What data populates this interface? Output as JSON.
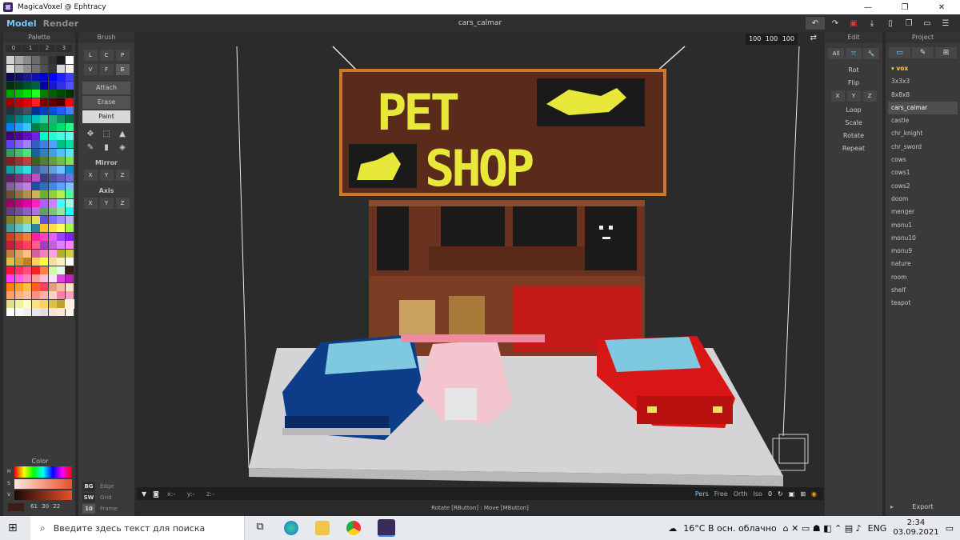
{
  "window": {
    "title": "MagicaVoxel @ Ephtracy",
    "minimize": "—",
    "maximize": "❐",
    "close": "✕"
  },
  "header": {
    "modes": [
      "Model",
      "Render"
    ],
    "filename": "cars_calmar",
    "tools": [
      "undo-icon",
      "redo-icon",
      "save-icon",
      "export-icon",
      "new-icon",
      "copy-icon",
      "open-icon",
      "menu-icon"
    ]
  },
  "palette": {
    "title": "Palette",
    "tabs": [
      "0",
      "1",
      "2",
      "3"
    ],
    "color_section": "Color",
    "hsv_labels": [
      "H",
      "S",
      "V"
    ],
    "rgb": "61 30 22",
    "colors": [
      "#d0d0d0",
      "#a8a8a8",
      "#8a8a8a",
      "#6a6a6a",
      "#4a4a4a",
      "#303030",
      "#1a1a1a",
      "#ffffff",
      "#e0e0e0",
      "#b0b0b0",
      "#909090",
      "#707070",
      "#505050",
      "#383838",
      "#d8d8d8",
      "#f0f0f0",
      "#0a0a50",
      "#10106a",
      "#181888",
      "#1010b0",
      "#0000d0",
      "#0000ff",
      "#2020ff",
      "#4040ff",
      "#003010",
      "#004020",
      "#005030",
      "#006040",
      "#0000a0",
      "#1818c8",
      "#3030e0",
      "#5050ff",
      "#00a000",
      "#00c000",
      "#00e000",
      "#20ff20",
      "#008000",
      "#006000",
      "#004800",
      "#003000",
      "#a00000",
      "#c00000",
      "#e00000",
      "#ff2020",
      "#800000",
      "#600000",
      "#480000",
      "#ff0000",
      "#203040",
      "#304050",
      "#405060",
      "#0030a0",
      "#0040c0",
      "#0050e0",
      "#2060ff",
      "#4080ff",
      "#006060",
      "#008080",
      "#00a0a0",
      "#00c0c0",
      "#30d0a0",
      "#20b080",
      "#109060",
      "#007040",
      "#0080ff",
      "#20a0ff",
      "#40c0ff",
      "#008040",
      "#00a050",
      "#00c060",
      "#00e070",
      "#20ff90",
      "#400080",
      "#5000a0",
      "#6010c0",
      "#7020e0",
      "#00ffc0",
      "#20ffd0",
      "#40ffe0",
      "#60fff0",
      "#6040ff",
      "#8060ff",
      "#a080ff",
      "#3060c0",
      "#4080e0",
      "#50a0ff",
      "#00c080",
      "#00e0a0",
      "#30a060",
      "#40c070",
      "#50e080",
      "#2060a0",
      "#3080c0",
      "#40a0e0",
      "#50c0ff",
      "#60e0ff",
      "#802020",
      "#a03030",
      "#c04040",
      "#406020",
      "#508030",
      "#60a040",
      "#70c050",
      "#80e060",
      "#10a0a0",
      "#20c0c0",
      "#30e0e0",
      "#4060a0",
      "#5080c0",
      "#60a0e0",
      "#70c0ff",
      "#1090d0",
      "#602060",
      "#803080",
      "#a040a0",
      "#c050c0",
      "#404080",
      "#5050a0",
      "#6060c0",
      "#7070e0",
      "#8060a0",
      "#a070c0",
      "#c080e0",
      "#2050a0",
      "#306fc0",
      "#4088e0",
      "#60a0ff",
      "#80c0ff",
      "#705030",
      "#907040",
      "#b09050",
      "#d0b060",
      "#70b030",
      "#90d040",
      "#b0f050",
      "#40ffa0",
      "#a00060",
      "#c00080",
      "#e000a0",
      "#ff20c0",
      "#b060ff",
      "#d080ff",
      "#40ffff",
      "#a0ffe0",
      "#604080",
      "#7050a0",
      "#9060c0",
      "#b070e0",
      "#60a060",
      "#80c080",
      "#a0e0a0",
      "#20ffff",
      "#808020",
      "#a0a030",
      "#c0c040",
      "#e0e050",
      "#6050e0",
      "#8070ff",
      "#a090ff",
      "#c0b0ff",
      "#40a0a0",
      "#60c0c0",
      "#80e0e0",
      "#3080a0",
      "#ffc030",
      "#ffe040",
      "#ffff60",
      "#a0ff40",
      "#d04020",
      "#e06030",
      "#f08040",
      "#ff20a0",
      "#ff40c0",
      "#e060ff",
      "#a040ff",
      "#8020ff",
      "#c02040",
      "#e03050",
      "#ff4060",
      "#ff6080",
      "#a040c0",
      "#c060e0",
      "#e080ff",
      "#ff80ff",
      "#c08040",
      "#e0a060",
      "#ffc080",
      "#d060a0",
      "#f080c0",
      "#ffa0e0",
      "#b0b030",
      "#d0d040",
      "#e0c040",
      "#d0a030",
      "#c08020",
      "#ffd060",
      "#ffff40",
      "#f0e0a0",
      "#fff0c0",
      "#ffffff",
      "#ff1040",
      "#ff3060",
      "#ff5080",
      "#ff2020",
      "#ff8040",
      "#d0ffa0",
      "#e0ffe0",
      "#3d1e16",
      "#ff40ff",
      "#ff60e0",
      "#ff80c0",
      "#ffa0a0",
      "#ffc0e0",
      "#ffe0ff",
      "#e040e0",
      "#c020c0",
      "#ff8000",
      "#ffa020",
      "#ffc040",
      "#ff6020",
      "#ff4060",
      "#e0a080",
      "#f0c0a0",
      "#ffe0c0",
      "#ffa060",
      "#ffb080",
      "#ffc0a0",
      "#ff9080",
      "#ffb0a0",
      "#ffd0c0",
      "#ff80a0",
      "#ffa0c0",
      "#e0e080",
      "#f0f0a0",
      "#ffffc0",
      "#ffe080",
      "#ffd060",
      "#e0c040",
      "#c0a030",
      "#fff0e0",
      "#ffffff",
      "#f8f8f8",
      "#f0f0f0",
      "#e8e8e8",
      "#e0e0e0",
      "#f4e4d4",
      "#ffe8d0",
      "#fff4e8"
    ]
  },
  "brush": {
    "title": "Brush",
    "shape_row1": [
      "L",
      "C",
      "P"
    ],
    "shape_row2": [
      "V",
      "F",
      "B"
    ],
    "modes": [
      "Attach",
      "Erase",
      "Paint"
    ],
    "active_mode": "Paint",
    "tool_icons": [
      "move-icon",
      "select-icon",
      "pick-shape-icon",
      "eyedropper-icon",
      "delete-icon",
      "fill-icon"
    ],
    "mirror_label": "Mirror",
    "mirror": [
      "X",
      "Y",
      "Z"
    ],
    "axis_label": "Axis",
    "axis": [
      "X",
      "Y",
      "Z"
    ],
    "bg": {
      "bg": "BG",
      "edge": "Edge",
      "sw": "SW",
      "grid": "Grid",
      "frame_num": "10",
      "frame": "Frame"
    }
  },
  "viewport": {
    "size": "100 100 100",
    "coords": "x:-   y:-   z:-",
    "views": [
      "Pers",
      "Free",
      "Orth",
      "Iso"
    ],
    "active_view": "Pers",
    "zoom": "0",
    "status": "Rotate [RButton] : Move [MButton]",
    "scene_text": {
      "pet": "PET",
      "shop": "SHOP"
    }
  },
  "edit": {
    "title": "Edit",
    "tabs": [
      "All",
      "⤧",
      "🔧"
    ],
    "items": [
      "Rot",
      "Flip",
      "Loop",
      "Scale",
      "Rotate",
      "Repeat"
    ],
    "flip_axes": [
      "X",
      "Y",
      "Z"
    ]
  },
  "project": {
    "title": "Project",
    "folder": "▾ vox",
    "files": [
      "3x3x3",
      "8x8x8",
      "cars_calmar",
      "castle",
      "chr_knight",
      "chr_sword",
      "cows",
      "cows1",
      "cows2",
      "doom",
      "menger",
      "monu1",
      "monu10",
      "monu9",
      "nature",
      "room",
      "shelf",
      "teapot"
    ],
    "selected": "cars_calmar",
    "export": "Export"
  },
  "taskbar": {
    "search_placeholder": "Введите здесь текст для поиска",
    "weather": "16°C  В осн. облачно",
    "lang": "ENG",
    "time": "2:34",
    "date": "03.09.2021"
  }
}
